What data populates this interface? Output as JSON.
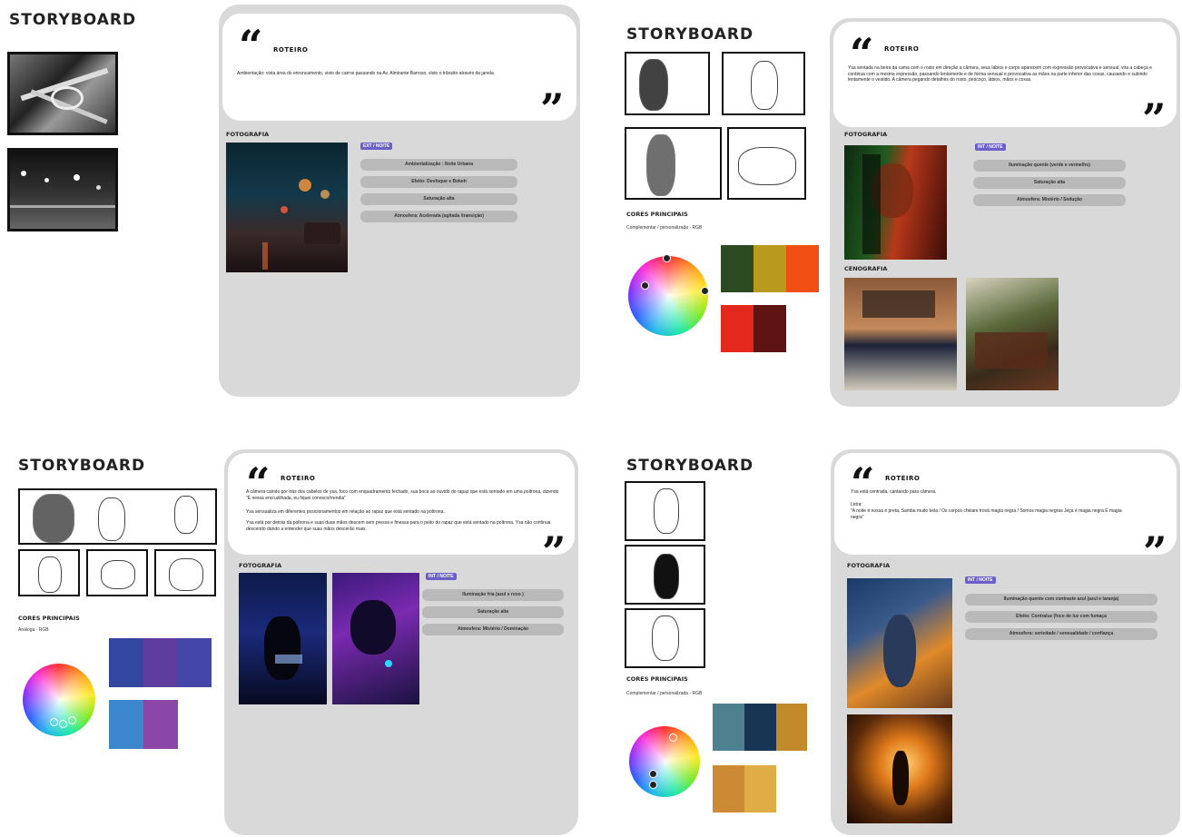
{
  "panels": [
    {
      "title": "STORYBOARD",
      "roteiro_label": "ROTEIRO",
      "script": "Ambientação: vista área do enroncamento, visto de carros passando na Av. Almirante Barroso, visto o trânsito através da janela.",
      "fotografia_label": "FOTOGRAFIA",
      "tag": "EXT / NOITE",
      "pills": [
        "Ambientalização : Noite Urbana",
        "Efeito: Desfoque e Bokeh",
        "Saturação alta",
        "Atmosfera: Acelerada (agitada /transição)"
      ]
    },
    {
      "title": "STORYBOARD",
      "roteiro_label": "ROTEIRO",
      "script": "Ysa sentada na beira da cama com o rosto em direção a câmera, seus lábios e corpo aparecem com expressão provocativa e sensual, vira a cabeça e continua com a mesma expressão, passando lentamente e de forma sensual e provocativa as mãos na parte inferior das coxas, causando e subindo lentamente o vestido. A câmera pegando detalhes do rosto, pescoço, lábios, mãos e coxas.",
      "fotografia_label": "FOTOGRAFIA",
      "tag": "INT / NOITE",
      "pills": [
        "Iluminação quente (verde e vermelho)",
        "Saturação alta",
        "Atmosfera: Mistério / Sedução"
      ],
      "cores_label": "CORES PRINCIPAIS",
      "cores_sub": "Complementar / personalizada - RGB",
      "cenografia_label": "CENOGRAFIA",
      "colors": [
        "#2c4a22",
        "#b99a1c",
        "#f04f14",
        "#e5281e",
        "#5e1410"
      ]
    },
    {
      "title": "STORYBOARD",
      "roteiro_label": "ROTEIRO",
      "script": "A câmera caindo por trás dos cabelos de ysa, foco com enquadramento fechado, sua boca ao ouvido do rapaz que está sentado em uma poltrona, dizendo \"É nessa encruzilhada, eu fiquei conosco/rrendia\"",
      "script2": "Ysa sensualiza em diferentes posicionamentos em relação ao rapaz que está sentado na poltrona.",
      "script3": "Ysa está por detrás da poltrona e suas duas mãos descem sem pressa e finessa para o peito do rapaz que está sentado na poltrona. Ysa não continua descendo dando a entender que suas mãos descerão mais.",
      "fotografia_label": "FOTOGRAFIA",
      "tag": "INT / NOITE",
      "pills": [
        "Iluminação fria (azul e roxo )",
        "Saturação alta",
        "Atmosfera: Mistério / Dominação"
      ],
      "cores_label": "CORES PRINCIPAIS",
      "cores_sub": "Análoga - RGB",
      "colors": [
        "#3347a0",
        "#5e3d9c",
        "#4446a8",
        "#3b86cc",
        "#8a47a8"
      ]
    },
    {
      "title": "STORYBOARD",
      "roteiro_label": "ROTEIRO",
      "script": "Ysa está centrada, cantando para câmera.",
      "script2": "Letra:",
      "script3": "\"A noite é nossa é preta, Samba muito bela / Os corpos cheiam trovã magia negra / Somos magia negras Jeça é magia negra É magia negra\"",
      "fotografia_label": "FOTOGRAFIA",
      "tag": "INT / NOITE",
      "pills": [
        "Iluminação quente com contraste azul (azul e laranja)",
        "Efeito: Contraluz (foco de luz com fumaça",
        "Atmosfera: seriedade / sensualidade / confiança"
      ],
      "cores_label": "CORES PRINCIPAIS",
      "cores_sub": "Complementar / personalizada - RGB",
      "colors": [
        "#4e8190",
        "#183654",
        "#c38a2c",
        "#cd8a34",
        "#e0ac46"
      ]
    }
  ],
  "quote_icons": {
    "open": "opening-quote-icon",
    "close": "closing-quote-icon"
  }
}
